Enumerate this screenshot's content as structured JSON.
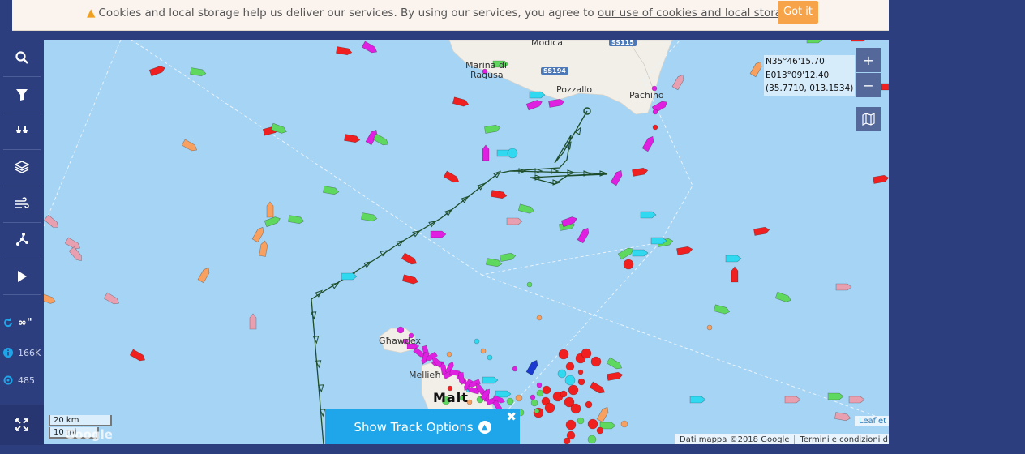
{
  "cookie": {
    "message": "Cookies and local storage help us deliver our services. By using our services, you agree to",
    "link": "our use of cookies and local storage",
    "button": "Got it"
  },
  "sidebar": {
    "items": [
      "search-icon",
      "filter-icon",
      "fleet-icon",
      "layers-icon",
      "weather-icon",
      "measure-icon",
      "playback-icon"
    ],
    "refresh_label": "∞\"",
    "vessels_count": "166K",
    "stations_count": "485",
    "fullscreen_icon": "fullscreen-icon"
  },
  "map": {
    "coords": {
      "lat": "N35°46'15.70",
      "lon": "E013°09'12.40",
      "decimal": "(35.7710, 013.1534)"
    },
    "zoom_in": "+",
    "zoom_out": "−",
    "scale_km": "20 km",
    "scale_mi": "10 mi",
    "google_logo": "Google",
    "track_button": "Show Track Options",
    "leaflet": "Leaflet",
    "attribution": [
      "Dati mappa ©2018 Google",
      "Termini e condizioni d'uso"
    ],
    "places": {
      "modica": "Modica",
      "marina": "Marina di",
      "ragusa": "Ragusa",
      "pozzallo": "Pozzallo",
      "pachino": "Pachino",
      "ghawdex": "Għawdex",
      "mellieha": "Mellieħ",
      "malta": "Malt"
    },
    "roads": {
      "r1": "SS115",
      "r2": "SS194"
    },
    "colors": {
      "sea": "#a6d4f5",
      "land": "#f2efe9",
      "track": "#1e4d2b",
      "sidebar": "#2d3e7e",
      "button": "#1fa6ea"
    }
  }
}
